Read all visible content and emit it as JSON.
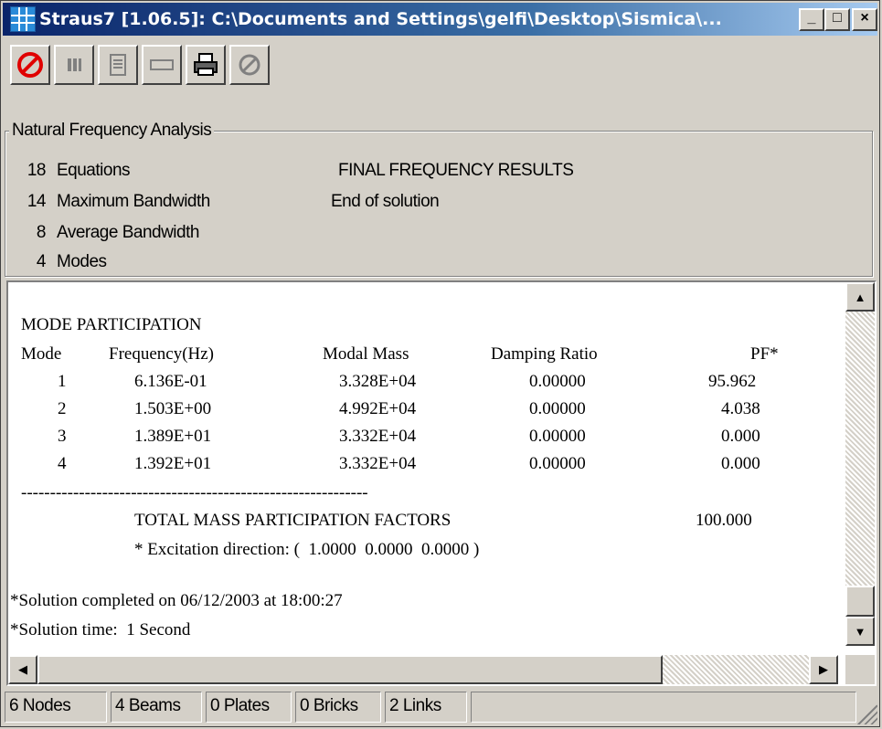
{
  "window": {
    "title": "Straus7 [1.06.5]: C:\\Documents and Settings\\gelfi\\Desktop\\Sismica\\...",
    "controls": {
      "minimize": "_",
      "maximize": "□",
      "close": "×"
    }
  },
  "toolbar": {
    "buttons": [
      "stop-icon",
      "pause-icon",
      "notes-icon",
      "minimize-window-icon",
      "print-icon",
      "refresh-icon"
    ]
  },
  "analysis": {
    "caption": "Natural Frequency Analysis",
    "stats": [
      {
        "value": "18",
        "label": "Equations"
      },
      {
        "value": "14",
        "label": "Maximum Bandwidth"
      },
      {
        "value": "8",
        "label": "Average Bandwidth"
      },
      {
        "value": "4",
        "label": "Modes"
      }
    ],
    "messages": [
      "FINAL FREQUENCY RESULTS",
      "End of solution"
    ]
  },
  "output": {
    "heading": "MODE PARTICIPATION",
    "columns": [
      "Mode",
      "Frequency(Hz)",
      "Modal Mass",
      "Damping Ratio",
      "PF*"
    ],
    "rows": [
      [
        "1",
        "6.136E-01",
        "3.328E+04",
        "0.00000",
        "95.962"
      ],
      [
        "2",
        "1.503E+00",
        "4.992E+04",
        "0.00000",
        "4.038"
      ],
      [
        "3",
        "1.389E+01",
        "3.332E+04",
        "0.00000",
        "0.000"
      ],
      [
        "4",
        "1.392E+01",
        "3.332E+04",
        "0.00000",
        "0.000"
      ]
    ],
    "separator": "------------------------------------------------------------",
    "total_label": "TOTAL MASS PARTICIPATION FACTORS",
    "total_value": "100.000",
    "excitation": "* Excitation direction: (  1.0000  0.0000  0.0000 )",
    "completed": "*Solution completed on 06/12/2003 at 18:00:27",
    "time": "*Solution time:  1 Second"
  },
  "statusbar": [
    "6 Nodes",
    "4 Beams",
    "0 Plates",
    "0 Bricks",
    "2 Links",
    ""
  ],
  "colors": {
    "title_start": "#0a246a",
    "title_end": "#a6caf0",
    "face": "#d4d0c8",
    "stop_red": "#e00000"
  }
}
